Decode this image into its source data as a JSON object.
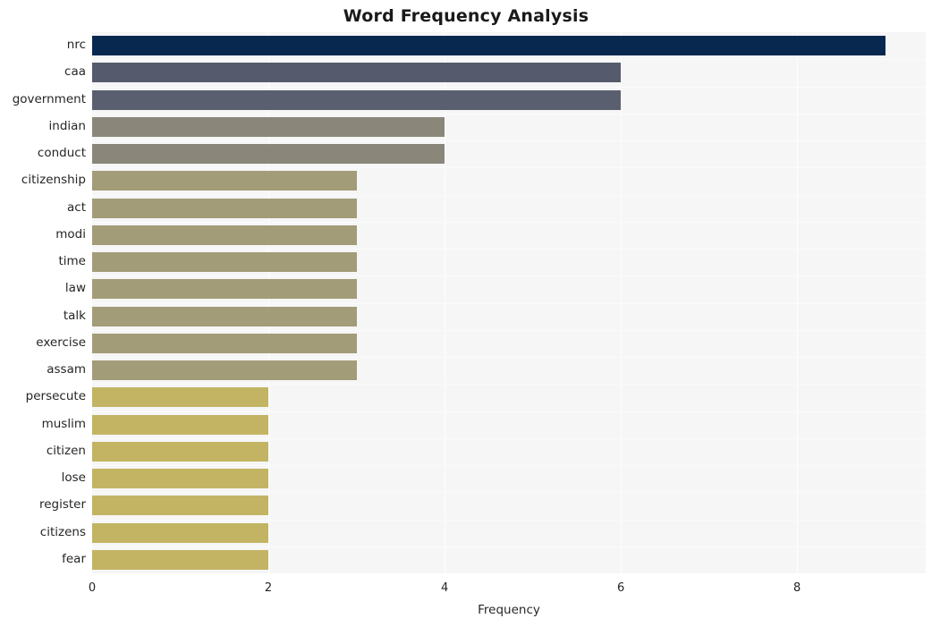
{
  "chart_data": {
    "type": "bar",
    "orientation": "horizontal",
    "title": "Word Frequency Analysis",
    "xlabel": "Frequency",
    "ylabel": "",
    "xlim": [
      0,
      9.46
    ],
    "xticks": [
      0,
      2,
      4,
      6,
      8
    ],
    "grid": "vertical-white-on-light-gray",
    "legend": "none",
    "categories": [
      "nrc",
      "caa",
      "government",
      "indian",
      "conduct",
      "citizenship",
      "act",
      "modi",
      "time",
      "law",
      "talk",
      "exercise",
      "assam",
      "persecute",
      "muslim",
      "citizen",
      "lose",
      "register",
      "citizens",
      "fear"
    ],
    "values": [
      9,
      6,
      6,
      4,
      4,
      3,
      3,
      3,
      3,
      3,
      3,
      3,
      3,
      2,
      2,
      2,
      2,
      2,
      2,
      2
    ],
    "bar_colors": [
      "#082850",
      "#555b6c",
      "#5a5f70",
      "#8a867a",
      "#8a867a",
      "#a29c78",
      "#a29c78",
      "#a29c78",
      "#a29c78",
      "#a29c78",
      "#a29c78",
      "#a29c78",
      "#a29c78",
      "#c3b464",
      "#c3b464",
      "#c3b464",
      "#c3b464",
      "#c3b464",
      "#c3b464",
      "#c3b464"
    ],
    "plot_background": "#f6f6f7",
    "figure_background": "#ffffff",
    "text_color": "#262626"
  }
}
